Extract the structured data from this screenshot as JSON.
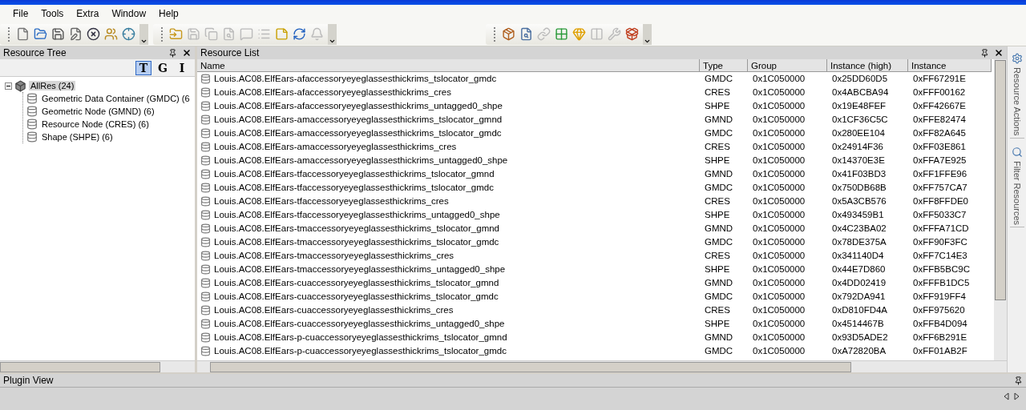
{
  "menu": [
    "File",
    "Tools",
    "Extra",
    "Window",
    "Help"
  ],
  "toolbars": [
    {
      "buttons": [
        {
          "kind": "new",
          "disabled": false
        },
        {
          "kind": "open",
          "disabled": false
        },
        {
          "kind": "save",
          "disabled": false
        },
        {
          "kind": "saveas",
          "disabled": false
        },
        {
          "kind": "close",
          "disabled": false
        },
        {
          "kind": "users",
          "disabled": false
        },
        {
          "kind": "target",
          "disabled": false
        }
      ]
    },
    {
      "buttons": [
        {
          "kind": "folder",
          "disabled": false
        },
        {
          "kind": "save",
          "disabled": true
        },
        {
          "kind": "copy",
          "disabled": true
        },
        {
          "kind": "search",
          "disabled": true
        },
        {
          "kind": "comment",
          "disabled": true
        },
        {
          "kind": "list",
          "disabled": true
        },
        {
          "kind": "note",
          "disabled": false
        },
        {
          "kind": "refresh",
          "disabled": false
        },
        {
          "kind": "bell",
          "disabled": true
        }
      ]
    },
    {
      "buttons": [
        {
          "kind": "package",
          "disabled": false
        },
        {
          "kind": "search",
          "disabled": false
        },
        {
          "kind": "link",
          "disabled": true
        },
        {
          "kind": "grid",
          "disabled": false
        },
        {
          "kind": "gem",
          "disabled": false
        },
        {
          "kind": "columns",
          "disabled": true
        },
        {
          "kind": "tools",
          "disabled": true
        },
        {
          "kind": "box",
          "disabled": false
        }
      ]
    }
  ],
  "resource_tree": {
    "title": "Resource Tree",
    "view_toggles": [
      {
        "label": "T",
        "selected": true
      },
      {
        "label": "G",
        "selected": false
      },
      {
        "label": "I",
        "selected": false
      }
    ],
    "items": [
      {
        "label": "AllRes (24)",
        "selected": true,
        "expanded": true,
        "children": [
          {
            "label": "Geometric Data Container (GMDC) (6",
            "selected": false
          },
          {
            "label": "Geometric Node (GMND) (6)",
            "selected": false
          },
          {
            "label": "Resource Node (CRES) (6)",
            "selected": false
          },
          {
            "label": "Shape (SHPE) (6)",
            "selected": false
          }
        ]
      }
    ]
  },
  "resource_list": {
    "title": "Resource List",
    "columns": [
      "Name",
      "Type",
      "Group",
      "Instance (high)",
      "Instance"
    ],
    "rows": [
      {
        "name": "Louis.AC08.ElfEars-afaccessoryeyeglassesthickrims_tslocator_gmdc",
        "type": "GMDC",
        "group": "0x1C050000",
        "instance_high": "0x25DD60D5",
        "instance": "0xFF67291E"
      },
      {
        "name": "Louis.AC08.ElfEars-afaccessoryeyeglassesthickrims_cres",
        "type": "CRES",
        "group": "0x1C050000",
        "instance_high": "0x4ABCBA94",
        "instance": "0xFFF00162"
      },
      {
        "name": "Louis.AC08.ElfEars-afaccessoryeyeglassesthickrims_untagged0_shpe",
        "type": "SHPE",
        "group": "0x1C050000",
        "instance_high": "0x19E48FEF",
        "instance": "0xFF42667E"
      },
      {
        "name": "Louis.AC08.ElfEars-amaccessoryeyeglassesthickrims_tslocator_gmnd",
        "type": "GMND",
        "group": "0x1C050000",
        "instance_high": "0x1CF36C5C",
        "instance": "0xFFE82474"
      },
      {
        "name": "Louis.AC08.ElfEars-amaccessoryeyeglassesthickrims_tslocator_gmdc",
        "type": "GMDC",
        "group": "0x1C050000",
        "instance_high": "0x280EE104",
        "instance": "0xFF82A645"
      },
      {
        "name": "Louis.AC08.ElfEars-amaccessoryeyeglassesthickrims_cres",
        "type": "CRES",
        "group": "0x1C050000",
        "instance_high": "0x24914F36",
        "instance": "0xFF03E861"
      },
      {
        "name": "Louis.AC08.ElfEars-amaccessoryeyeglassesthickrims_untagged0_shpe",
        "type": "SHPE",
        "group": "0x1C050000",
        "instance_high": "0x14370E3E",
        "instance": "0xFFA7E925"
      },
      {
        "name": "Louis.AC08.ElfEars-tfaccessoryeyeglassesthickrims_tslocator_gmnd",
        "type": "GMND",
        "group": "0x1C050000",
        "instance_high": "0x41F03BD3",
        "instance": "0xFF1FFE96"
      },
      {
        "name": "Louis.AC08.ElfEars-tfaccessoryeyeglassesthickrims_tslocator_gmdc",
        "type": "GMDC",
        "group": "0x1C050000",
        "instance_high": "0x750DB68B",
        "instance": "0xFF757CA7"
      },
      {
        "name": "Louis.AC08.ElfEars-tfaccessoryeyeglassesthickrims_cres",
        "type": "CRES",
        "group": "0x1C050000",
        "instance_high": "0x5A3CB576",
        "instance": "0xFF8FFDE0"
      },
      {
        "name": "Louis.AC08.ElfEars-tfaccessoryeyeglassesthickrims_untagged0_shpe",
        "type": "SHPE",
        "group": "0x1C050000",
        "instance_high": "0x493459B1",
        "instance": "0xFF5033C7"
      },
      {
        "name": "Louis.AC08.ElfEars-tmaccessoryeyeglassesthickrims_tslocator_gmnd",
        "type": "GMND",
        "group": "0x1C050000",
        "instance_high": "0x4C23BA02",
        "instance": "0xFFFA71CD"
      },
      {
        "name": "Louis.AC08.ElfEars-tmaccessoryeyeglassesthickrims_tslocator_gmdc",
        "type": "GMDC",
        "group": "0x1C050000",
        "instance_high": "0x78DE375A",
        "instance": "0xFF90F3FC"
      },
      {
        "name": "Louis.AC08.ElfEars-tmaccessoryeyeglassesthickrims_cres",
        "type": "CRES",
        "group": "0x1C050000",
        "instance_high": "0x341140D4",
        "instance": "0xFF7C14E3"
      },
      {
        "name": "Louis.AC08.ElfEars-tmaccessoryeyeglassesthickrims_untagged0_shpe",
        "type": "SHPE",
        "group": "0x1C050000",
        "instance_high": "0x44E7D860",
        "instance": "0xFFB5BC9C"
      },
      {
        "name": "Louis.AC08.ElfEars-cuaccessoryeyeglassesthickrims_tslocator_gmnd",
        "type": "GMND",
        "group": "0x1C050000",
        "instance_high": "0x4DD02419",
        "instance": "0xFFFB1DC5"
      },
      {
        "name": "Louis.AC08.ElfEars-cuaccessoryeyeglassesthickrims_tslocator_gmdc",
        "type": "GMDC",
        "group": "0x1C050000",
        "instance_high": "0x792DA941",
        "instance": "0xFF919FF4"
      },
      {
        "name": "Louis.AC08.ElfEars-cuaccessoryeyeglassesthickrims_cres",
        "type": "CRES",
        "group": "0x1C050000",
        "instance_high": "0xD810FD4A",
        "instance": "0xFF975620"
      },
      {
        "name": "Louis.AC08.ElfEars-cuaccessoryeyeglassesthickrims_untagged0_shpe",
        "type": "SHPE",
        "group": "0x1C050000",
        "instance_high": "0x4514467B",
        "instance": "0xFFB4D094"
      },
      {
        "name": "Louis.AC08.ElfEars-p-cuaccessoryeyeglassesthickrims_tslocator_gmnd",
        "type": "GMND",
        "group": "0x1C050000",
        "instance_high": "0x93D5ADE2",
        "instance": "0xFF6B291E"
      },
      {
        "name": "Louis.AC08.ElfEars-p-cuaccessoryeyeglassesthickrims_tslocator_gmdc",
        "type": "GMDC",
        "group": "0x1C050000",
        "instance_high": "0xA72820BA",
        "instance": "0xFF01AB2F"
      }
    ]
  },
  "side_tabs": [
    {
      "label": "Resource Actions",
      "kind": "actions"
    },
    {
      "label": "Filter Resources",
      "kind": "filter"
    }
  ],
  "plugin_view": {
    "title": "Plugin View"
  }
}
